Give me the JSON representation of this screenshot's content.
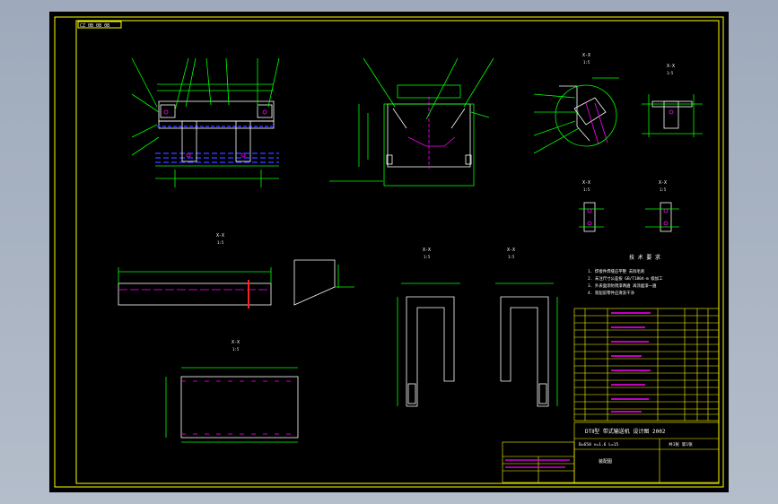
{
  "drawing": {
    "title_tag": "CZ 0B 0B 0B",
    "section_labels": [
      "X-X",
      "X-X",
      "X-X",
      "X-X",
      "X-X",
      "X-X",
      "X-X",
      "X-X"
    ],
    "scale_labels": [
      "1:5",
      "1:5",
      "1:5",
      "1:5",
      "1:5",
      "1:5",
      "1:5",
      "1:5"
    ],
    "tech_req_title": "技 术 要 求",
    "tech_req_lines": [
      "1. 焊接件焊缝应平整 去除毛刺",
      "2. 未注尺寸公差按 GB/T1804-m 级加工",
      "3. 外表面涂防锈漆两遍 再涂面漆一遍",
      "4. 装配前零件应清洗干净"
    ],
    "title_block": {
      "main_title": "DTⅡ型 带式输送机 设计图 2002",
      "sub_title": "B=650 v=1.6 L=15",
      "material": "装配图",
      "sheet": "共1张 第1张"
    },
    "colors": {
      "paper": "#000000",
      "outline": "#ffffff",
      "dims": "#00ff00",
      "leaders": "#00ff00",
      "magenta": "#ff00ff",
      "yellow": "#ffff00",
      "blue": "#3333ff",
      "red": "#ff2020"
    }
  }
}
